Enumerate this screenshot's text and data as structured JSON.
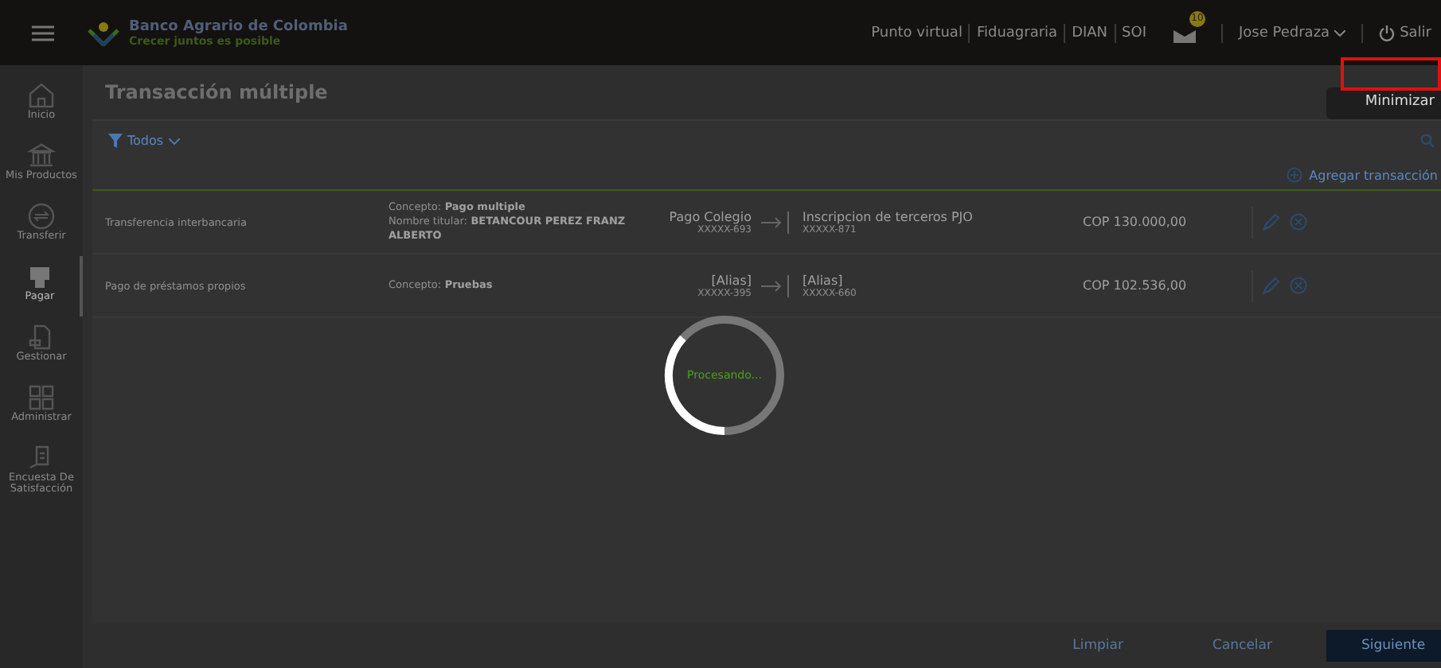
{
  "header": {
    "bank_name": "Banco Agrario de Colombia",
    "slogan": "Crecer juntos es posible",
    "links": [
      "Punto virtual",
      "Fiduagraria",
      "DIAN",
      "SOI"
    ],
    "notification_count": "10",
    "user": "Jose Pedraza",
    "logout": "Salir"
  },
  "sidebar": {
    "items": [
      {
        "label": "Inicio",
        "selected": false
      },
      {
        "label": "Mis Productos",
        "selected": false
      },
      {
        "label": "Transferir",
        "selected": false
      },
      {
        "label": "Pagar",
        "selected": true
      },
      {
        "label": "Gestionar",
        "selected": false
      },
      {
        "label": "Administrar",
        "selected": false
      },
      {
        "label": "Encuesta De Satisfacción",
        "selected": false
      }
    ]
  },
  "page_title": "Transacción múltiple",
  "tooltip": "Minimizar",
  "filter": {
    "label": "Todos"
  },
  "add_transaction": "Agregar transacción",
  "rows": [
    {
      "type": "Transferencia interbancaria",
      "concept_label": "Concepto:",
      "concept": "Pago multiple",
      "holder_label": "Nombre titular:",
      "holder": "BETANCOUR PEREZ FRANZ ALBERTO",
      "from_name": "Pago Colegio",
      "from_account": "XXXXX-693",
      "to_name": "Inscripcion de terceros PJO",
      "to_account": "XXXXX-871",
      "amount": "COP 130.000,00"
    },
    {
      "type": "Pago de préstamos propios",
      "concept_label": "Concepto:",
      "concept": "Pruebas",
      "from_name": "[Alias]",
      "from_account": "XXXXX-395",
      "to_name": "[Alias]",
      "to_account": "XXXXX-660",
      "amount": "COP 102.536,00"
    }
  ],
  "loading": {
    "text": "Procesando..."
  },
  "footer_buttons": [
    {
      "label": "Limpiar",
      "kind": "text"
    },
    {
      "label": "Cancelar",
      "kind": "text"
    },
    {
      "label": "Siguiente",
      "kind": "primary"
    }
  ]
}
